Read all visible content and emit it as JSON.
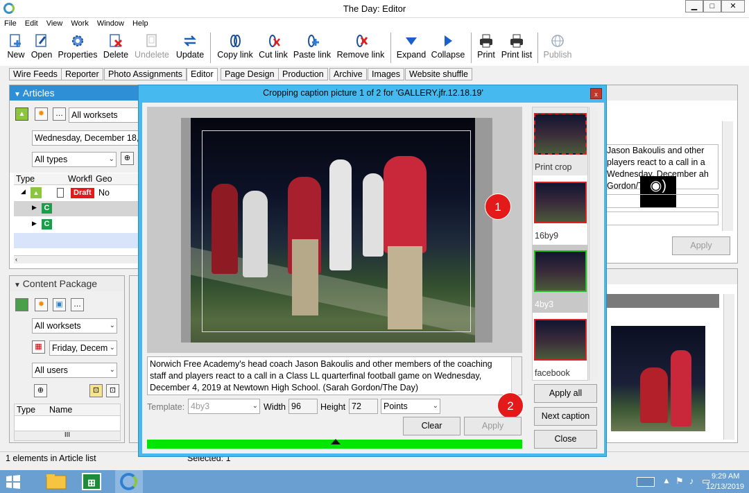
{
  "window": {
    "title": "The Day: Editor",
    "minimize": "▁",
    "maximize": "□",
    "close": "✕"
  },
  "menu": [
    "File",
    "Edit",
    "View",
    "Work",
    "Window",
    "Help"
  ],
  "toolbar": {
    "new": "New",
    "open": "Open",
    "properties": "Properties",
    "delete": "Delete",
    "undelete": "Undelete",
    "update": "Update",
    "copy_link": "Copy link",
    "cut_link": "Cut link",
    "paste_link": "Paste link",
    "remove_link": "Remove link",
    "expand": "Expand",
    "collapse": "Collapse",
    "print": "Print",
    "print_list": "Print list",
    "publish": "Publish"
  },
  "tabs": [
    "Wire Feeds",
    "Reporter",
    "Photo Assignments",
    "Editor",
    "Page Design",
    "Production",
    "Archive",
    "Images",
    "Website shuffle"
  ],
  "articles": {
    "header": "Articles",
    "worksets": "All worksets",
    "date": "Wednesday, December 18,",
    "types": "All types",
    "columns": [
      "Type",
      "",
      "Workfl",
      "Geo",
      "",
      ""
    ],
    "row_draft": "Draft",
    "row_geo": "No",
    "child": "C"
  },
  "content_package": {
    "header": "Content Package",
    "worksets": "All worksets",
    "date": "Friday, Decem",
    "users": "All users",
    "columns": [
      "Type",
      "",
      "Name",
      ""
    ],
    "hscroll": "III"
  },
  "right_panel": {
    "caption": "Jason Bakoulis and other players react to a call in a Wednesday, December ah Gordon/The Day)",
    "apply": "Apply"
  },
  "dialog": {
    "title": "Cropping caption picture 1 of 2 for 'GALLERY.jfr.12.18.19'",
    "close": "x",
    "caption": "Norwich Free Academy's head coach Jason Bakoulis and other members of the coaching staff and players react to a call in a Class LL quarterfinal football game on Wednesday, December 4, 2019 at Newtown High School. (Sarah Gordon/The Day)",
    "template_label": "Template:",
    "template_value": "4by3",
    "width_label": "Width",
    "width_value": "96",
    "height_label": "Height",
    "height_value": "72",
    "units": "Points",
    "clear": "Clear",
    "apply": "Apply",
    "apply_all": "Apply all",
    "next_caption": "Next caption",
    "close_btn": "Close",
    "badge1": "1",
    "badge2": "2",
    "thumbs": [
      "Print crop",
      "16by9",
      "4by3",
      "facebook"
    ]
  },
  "status": {
    "left": "1 elements in Article list",
    "mid": "Selected: 1"
  },
  "taskbar": {
    "time": "9:29 AM",
    "date": "12/13/2019"
  }
}
